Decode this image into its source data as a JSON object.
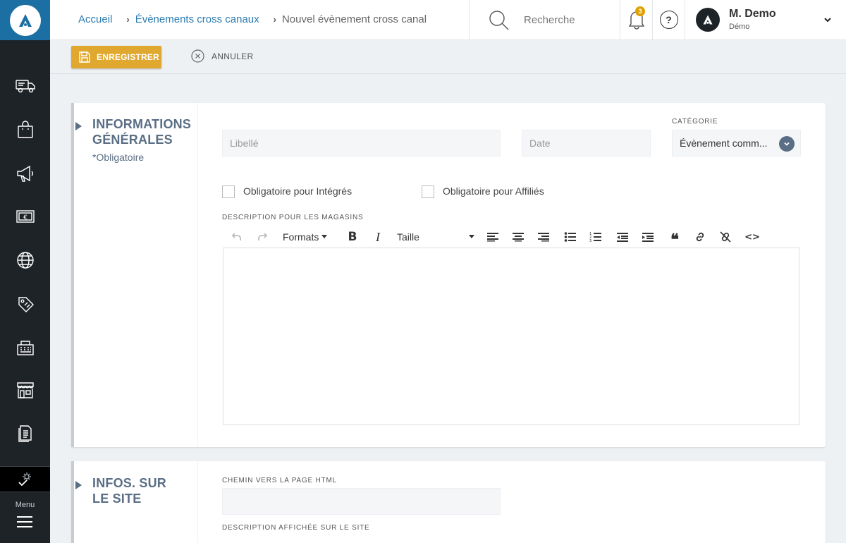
{
  "app": {
    "logo_icon": "brand-logo-icon"
  },
  "sidebar": {
    "items": [
      {
        "name": "delivery-truck-icon"
      },
      {
        "name": "shopping-bag-icon"
      },
      {
        "name": "megaphone-icon"
      },
      {
        "name": "euro-banknote-icon"
      },
      {
        "name": "globe-icon"
      },
      {
        "name": "price-tag-icon"
      },
      {
        "name": "cash-register-icon"
      },
      {
        "name": "store-icon"
      },
      {
        "name": "document-icon"
      },
      {
        "name": "settings-check-icon"
      }
    ],
    "menu_label": "Menu"
  },
  "header": {
    "breadcrumb": [
      "Accueil",
      "Évènements cross canaux",
      "Nouvel évènement cross canal"
    ],
    "search_placeholder": "Recherche",
    "notification_count": "3",
    "help_label": "?",
    "user_name": "M. Demo",
    "user_role": "Démo"
  },
  "actions": {
    "save_label": "ENREGISTRER",
    "cancel_label": "ANNULER"
  },
  "section_general": {
    "title_line1": "INFORMATIONS",
    "title_line2": "GÉNÉRALES",
    "required_note": "*Obligatoire",
    "libelle_placeholder": "Libellé",
    "date_placeholder": "Date",
    "category_label": "CATÉGORIE",
    "category_value": "Évènement comm...",
    "checkbox_integres": "Obligatoire pour Intégrés",
    "checkbox_affilies": "Obligatoire pour Affiliés",
    "description_label": "DESCRIPTION POUR LES MAGASINS",
    "editor": {
      "formats_label": "Formats",
      "size_label": "Taille",
      "bold_label": "B",
      "italic_label": "I",
      "quote_label": "❝",
      "code_label": "<>"
    }
  },
  "section_site": {
    "title_line1": "INFOS. SUR",
    "title_line2": "LE SITE",
    "html_path_label": "CHEMIN VERS LA PAGE HTML",
    "site_description_label": "DESCRIPTION AFFICHÉE SUR LE SITE"
  },
  "colors": {
    "sidebar": "#1e2328",
    "logo_bg": "#1b6fa3",
    "accent_save": "#e0a82e",
    "section_title": "#5a6e85",
    "link": "#2b7bb1",
    "badge": "#e0a000"
  }
}
